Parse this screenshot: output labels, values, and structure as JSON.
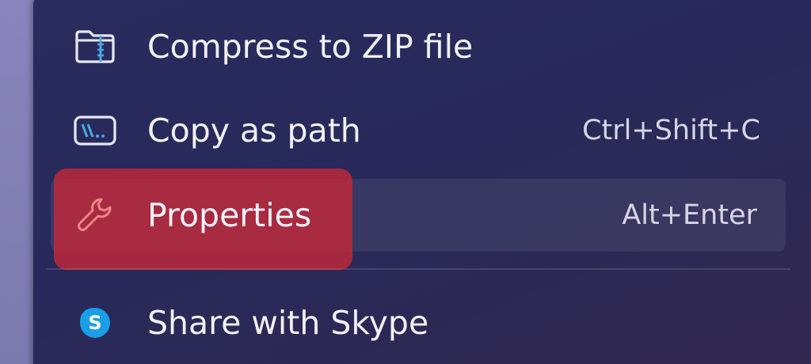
{
  "menu": {
    "items": [
      {
        "id": "compress",
        "label": "Compress to ZIP file",
        "shortcut": "",
        "icon": "zip-folder-icon"
      },
      {
        "id": "copy-path",
        "label": "Copy as path",
        "shortcut": "Ctrl+Shift+C",
        "icon": "copy-path-icon"
      },
      {
        "id": "properties",
        "label": "Properties",
        "shortcut": "Alt+Enter",
        "icon": "wrench-icon",
        "state": "hover-highlighted"
      },
      {
        "id": "skype",
        "label": "Share with Skype",
        "shortcut": "",
        "icon": "skype-icon"
      }
    ]
  },
  "colors": {
    "menu_background": "#2a2c5e",
    "highlight": "#c82837",
    "text": "#f1f1f7",
    "highlight_text": "#f08585",
    "icon_accent": "#4aa8e0",
    "skype_blue": "#1a9ee8"
  }
}
